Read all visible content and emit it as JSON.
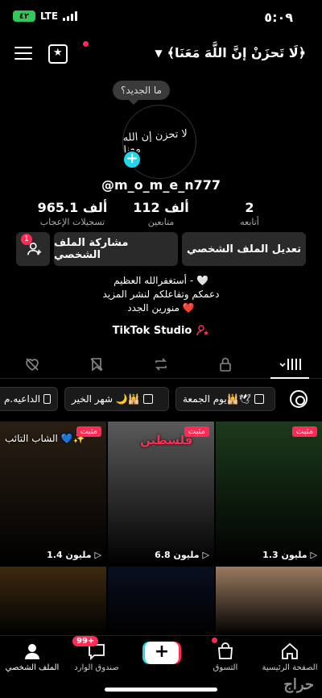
{
  "status_bar": {
    "time": "٥:٠٩",
    "network": "LTE",
    "battery": "٤٢"
  },
  "header": {
    "title": "﴿لَا تَحزَنْ إنَّ اللَّهَ مَعَنَا﴾",
    "menu_icon": "hamburger-icon",
    "calendar_icon": "calendar-star-icon"
  },
  "profile": {
    "avatar_text": "لا تحزن إن الله معنا",
    "bubble": "ما الجديد؟",
    "username": "@m_o_m_e_n777",
    "stats": [
      {
        "num": "2",
        "label": "أتابعه"
      },
      {
        "num": "112 ألف",
        "label": "متابعين"
      },
      {
        "num": "965.1 ألف",
        "label": "تسجيلات الإعجاب"
      }
    ],
    "buttons": {
      "edit": "تعديل الملف الشخصي",
      "share": "مشاركة الملف الشخصي",
      "add_friends_badge": "1"
    },
    "bio": [
      "أستغفرالله العظيم - 🤍",
      "دعمكم وتفاعلكم لنشر المزيد",
      "منورين الجدد ❤️"
    ],
    "studio": "TikTok Studio"
  },
  "chips": [
    "يوم الجمعة🕌🕊",
    "شهر الخير 🌙🕌",
    "الداعيه.م"
  ],
  "videos": [
    {
      "views": "1.3 مليون",
      "pinned": "مثبت",
      "title": "",
      "bg": "#1c3a1c"
    },
    {
      "views": "6.8 مليون",
      "pinned": "مثبت",
      "title": "فلسطين",
      "bg": "#5a5a5a"
    },
    {
      "views": "1.4 مليون",
      "pinned": "مثبت",
      "title": "الشاب التائب 💙✨",
      "bg": "#2a1f14"
    },
    {
      "views": "",
      "pinned": "",
      "title": "",
      "bg": "#3d2a10"
    },
    {
      "views": "",
      "pinned": "",
      "title": "",
      "bg": "#0a0f20"
    },
    {
      "views": "",
      "pinned": "",
      "title": "",
      "bg": "#9a7a60"
    }
  ],
  "nav": {
    "home": "الصفحة الرئيسية",
    "shop": "التسوق",
    "inbox": "صندوق الوارد",
    "inbox_badge": "99+",
    "profile": "الملف الشخصي"
  },
  "watermark": "حراج"
}
